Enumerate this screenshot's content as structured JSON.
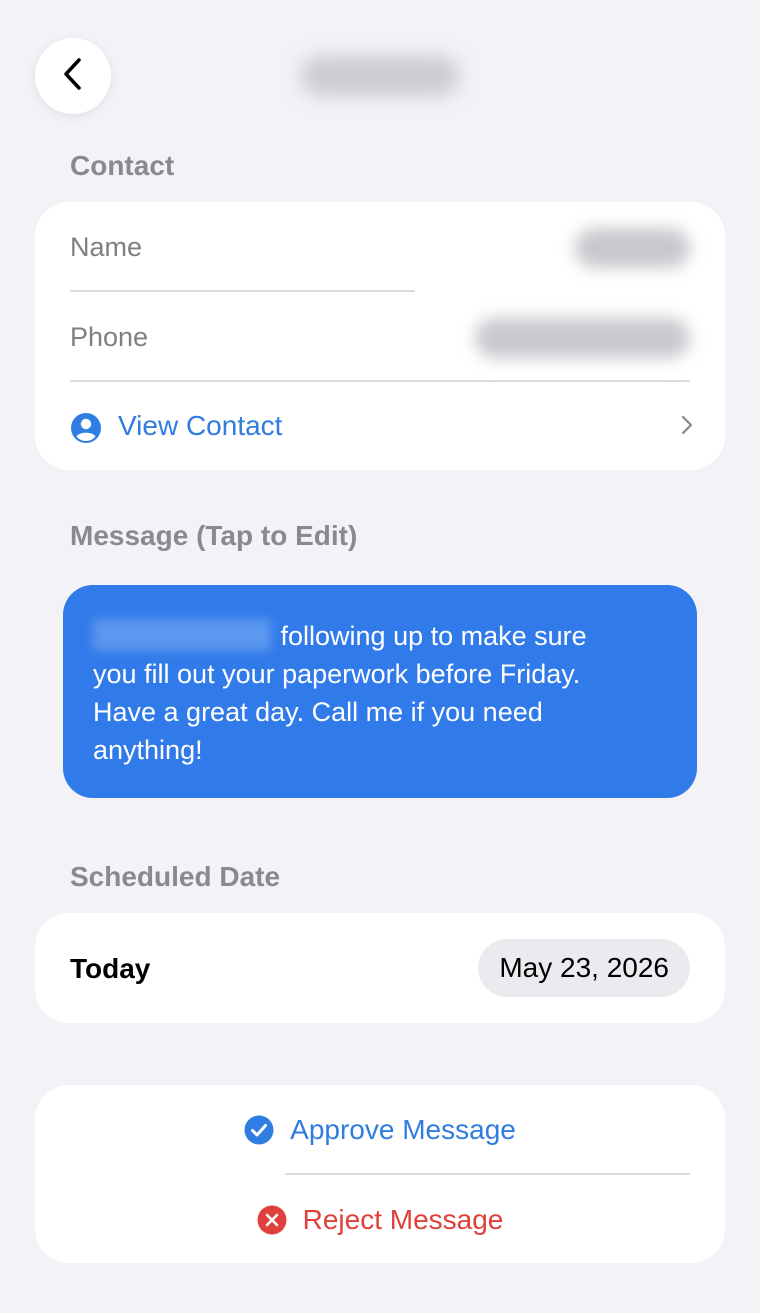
{
  "header": {
    "back_icon": "chevron-left-icon",
    "title": ""
  },
  "contact": {
    "section_title": "Contact",
    "name_label": "Name",
    "phone_label": "Phone",
    "view_contact_label": "View Contact",
    "person_icon": "person-circle-icon",
    "chevron_icon": "chevron-right-icon"
  },
  "message": {
    "section_title": "Message (Tap to Edit)",
    "text_line1": "following up to make sure",
    "text_line2": "you fill out your paperwork before Friday.",
    "text_line3": "Have a great day.  Call me if you need",
    "text_line4": "anything!",
    "bubble_color": "#317ae9"
  },
  "schedule": {
    "section_title": "Scheduled Date",
    "day_label": "Today",
    "date_value": "May 23, 2026"
  },
  "actions": {
    "approve_label": "Approve Message",
    "approve_icon": "checkmark-circle-icon",
    "approve_color": "#2f7de1",
    "reject_label": "Reject Message",
    "reject_icon": "x-circle-icon",
    "reject_color": "#e0403a"
  }
}
